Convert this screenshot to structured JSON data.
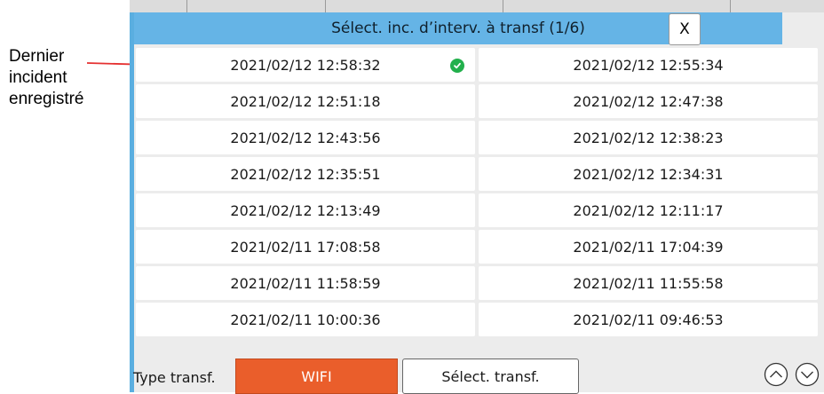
{
  "callout": {
    "lines": [
      "Dernier",
      "incident",
      "enregistré"
    ],
    "color": "#e53030"
  },
  "dialog": {
    "title": "Sélect. inc. d’interv. à transf (1/6)",
    "close_label": "X",
    "accent_color": "#65b4e6"
  },
  "incidents": [
    {
      "left": "2021/02/12 12:58:32",
      "right": "2021/02/12 12:55:34",
      "left_checked": true
    },
    {
      "left": "2021/02/12 12:51:18",
      "right": "2021/02/12 12:47:38"
    },
    {
      "left": "2021/02/12 12:43:56",
      "right": "2021/02/12 12:38:23"
    },
    {
      "left": "2021/02/12 12:35:51",
      "right": "2021/02/12 12:34:31"
    },
    {
      "left": "2021/02/12 12:13:49",
      "right": "2021/02/12 12:11:17"
    },
    {
      "left": "2021/02/11 17:08:58",
      "right": "2021/02/11 17:04:39"
    },
    {
      "left": "2021/02/11 11:58:59",
      "right": "2021/02/11 11:55:58"
    },
    {
      "left": "2021/02/11 10:00:36",
      "right": "2021/02/11 09:46:53"
    }
  ],
  "footer": {
    "type_label": "Type transf.",
    "wifi_label": "WIFI",
    "wifi_color": "#ea5e2b",
    "select_label": "Sélect. transf.",
    "up_icon": "chevron-up-circle-icon",
    "down_icon": "chevron-down-circle-icon"
  }
}
